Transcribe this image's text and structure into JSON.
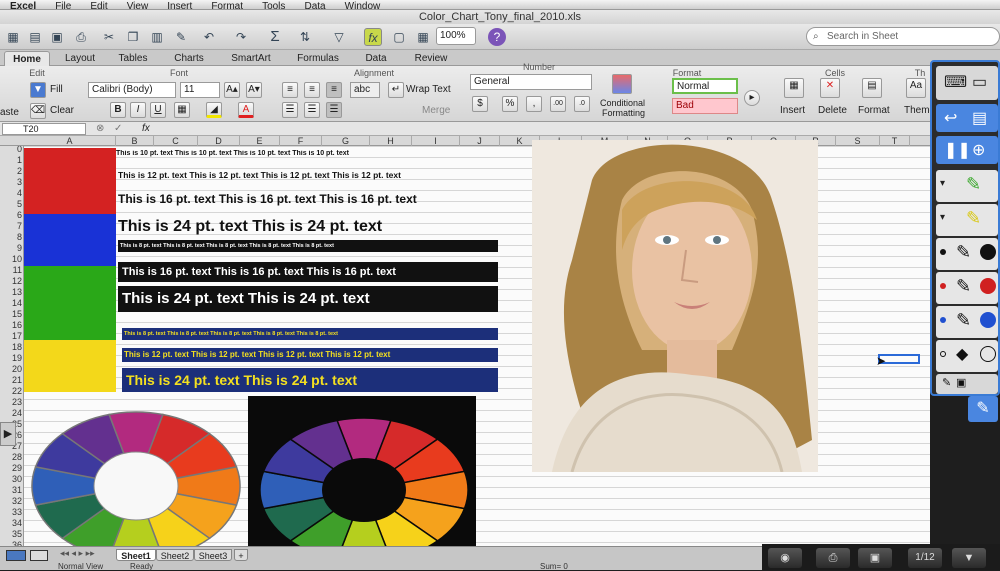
{
  "menubar": {
    "app": "Excel",
    "items": [
      "File",
      "Edit",
      "View",
      "Insert",
      "Format",
      "Tools",
      "Data",
      "Window"
    ]
  },
  "window": {
    "title": "Color_Chart_Tony_final_2010.xls"
  },
  "toolbar": {
    "zoom": "100%",
    "search_placeholder": "Search in Sheet"
  },
  "ribbon": {
    "tabs": [
      "Home",
      "Layout",
      "Tables",
      "Charts",
      "SmartArt",
      "Formulas",
      "Data",
      "Review"
    ],
    "groups": {
      "edit": "Edit",
      "font": "Font",
      "alignment": "Alignment",
      "number": "Number",
      "format": "Format",
      "cells": "Cells",
      "themes": "Th"
    },
    "fill_label": "Fill",
    "clear_label": "Clear",
    "paste_label": "aste",
    "font_name": "Calibri (Body)",
    "font_size": "11",
    "wrap_text": "Wrap Text",
    "merge": "Merge",
    "abc": "abc",
    "number_format": "General",
    "conditional": "Conditional",
    "formatting": "Formatting",
    "style_normal": "Normal",
    "style_bad": "Bad",
    "insert": "Insert",
    "delete": "Delete",
    "format_btn": "Format",
    "theme": "Theme"
  },
  "formula_bar": {
    "cell": "T20",
    "fx": "fx"
  },
  "columns": [
    "A",
    "B",
    "C",
    "D",
    "E",
    "F",
    "G",
    "H",
    "I",
    "J",
    "K",
    "L",
    "M",
    "N",
    "O",
    "P",
    "Q",
    "R",
    "S",
    "T"
  ],
  "rows": [
    "0",
    "1",
    "2",
    "3",
    "4",
    "5",
    "6",
    "7",
    "8",
    "9",
    "10",
    "11",
    "12",
    "13",
    "14",
    "15",
    "16",
    "17",
    "18",
    "19",
    "20",
    "21",
    "22",
    "23",
    "24",
    "25",
    "26",
    "27",
    "28",
    "29",
    "30",
    "31",
    "32",
    "33",
    "34",
    "35",
    "36"
  ],
  "text_rows": {
    "t10": "This is 10 pt. text   This is 10 pt. text   This is 10 pt. text   This is 10 pt. text",
    "t12": "This is 12 pt. text   This is 12 pt. text   This is 12 pt. text   This is 12 pt. text",
    "t16": "This is 16 pt. text   This is 16 pt. text   This is 16 pt. text",
    "t24": "This is 24 pt. text   This is 24 pt. text",
    "t8": "This is 8 pt. text   This is 8 pt. text   This is 8 pt. text   This is 8 pt. text   This is 8 pt. text"
  },
  "swatch_colors": {
    "red": "#d42222",
    "blue": "#1932d6",
    "green": "#2aa818",
    "yellow": "#f3d81a"
  },
  "sheets": {
    "tabs": [
      "Sheet1",
      "Sheet2",
      "Sheet3"
    ],
    "add": "+"
  },
  "status": {
    "view": "Normal View",
    "state": "Ready",
    "sum": "Sum= 0"
  },
  "dock": {
    "page": "1/12"
  }
}
